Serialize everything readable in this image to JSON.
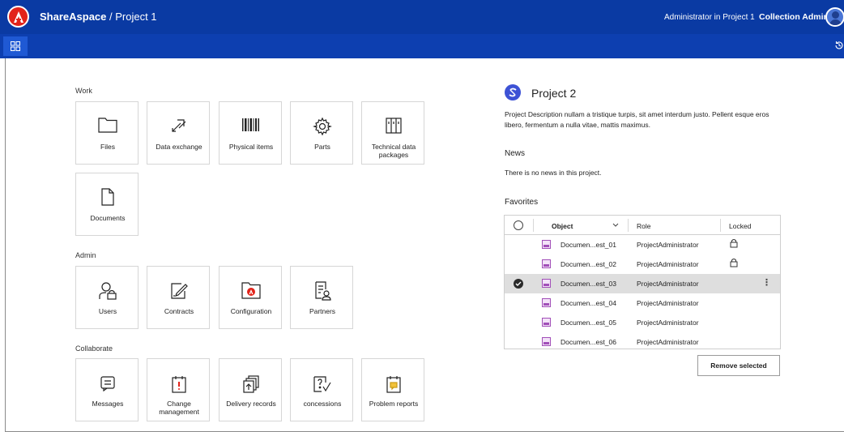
{
  "header": {
    "app_name": "ShareAspace",
    "separator": " / ",
    "project": "Project 1",
    "user_context": "Administrator in Project 1",
    "collection_admin": "Collection Admin"
  },
  "icons": {
    "logo": "shareaspace-logo-icon",
    "apps": "apps-grid-icon",
    "history": "history-icon",
    "avatar": "user-avatar-icon"
  },
  "sections": {
    "work": {
      "label": "Work",
      "tiles": [
        {
          "label": "Files",
          "icon": "folder-icon"
        },
        {
          "label": "Data exchange",
          "icon": "data-exchange-icon"
        },
        {
          "label": "Physical items",
          "icon": "barcode-icon"
        },
        {
          "label": "Parts",
          "icon": "gear-icon"
        },
        {
          "label": "Technical data packages",
          "icon": "package-icon"
        },
        {
          "label": "Documents",
          "icon": "document-icon"
        }
      ]
    },
    "admin": {
      "label": "Admin",
      "tiles": [
        {
          "label": "Users",
          "icon": "user-lock-icon"
        },
        {
          "label": "Contracts",
          "icon": "contract-edit-icon"
        },
        {
          "label": "Configuration",
          "icon": "config-folder-icon"
        },
        {
          "label": "Partners",
          "icon": "partners-icon"
        }
      ]
    },
    "collaborate": {
      "label": "Collaborate",
      "tiles": [
        {
          "label": "Messages",
          "icon": "message-icon"
        },
        {
          "label": "Change management",
          "icon": "change-management-icon"
        },
        {
          "label": "Delivery records",
          "icon": "delivery-records-icon"
        },
        {
          "label": "concessions",
          "icon": "concessions-icon"
        },
        {
          "label": "Problem reports",
          "icon": "problem-report-icon"
        }
      ]
    }
  },
  "project_panel": {
    "title": "Project 2",
    "description": "Project Description nullam a tristique turpis, sit amet interdum justo. Pellent esque eros libero, fermentum a nulla vitae, mattis maximus.",
    "news_heading": "News",
    "news_text": "There is no news in this project.",
    "favorites_heading": "Favorites",
    "favorites": {
      "columns": [
        "Object",
        "Role",
        "Locked"
      ],
      "rows": [
        {
          "object": "Documen...est_01",
          "role": "ProjectAdministrator",
          "locked": true,
          "selected": false
        },
        {
          "object": "Documen...est_02",
          "role": "ProjectAdministrator",
          "locked": true,
          "selected": false
        },
        {
          "object": "Documen...est_03",
          "role": "ProjectAdministrator",
          "locked": false,
          "selected": true
        },
        {
          "object": "Documen...est_04",
          "role": "ProjectAdministrator",
          "locked": false,
          "selected": false
        },
        {
          "object": "Documen...est_05",
          "role": "ProjectAdministrator",
          "locked": false,
          "selected": false
        },
        {
          "object": "Documen...est_06",
          "role": "ProjectAdministrator",
          "locked": false,
          "selected": false
        }
      ]
    },
    "remove_button": "Remove selected"
  },
  "colors": {
    "topbar": "#0a3aa3",
    "subbar": "#0d3fb0",
    "logo": "#e2231a",
    "selected_row": "#dedede",
    "document_icon": "#a14fb8"
  }
}
